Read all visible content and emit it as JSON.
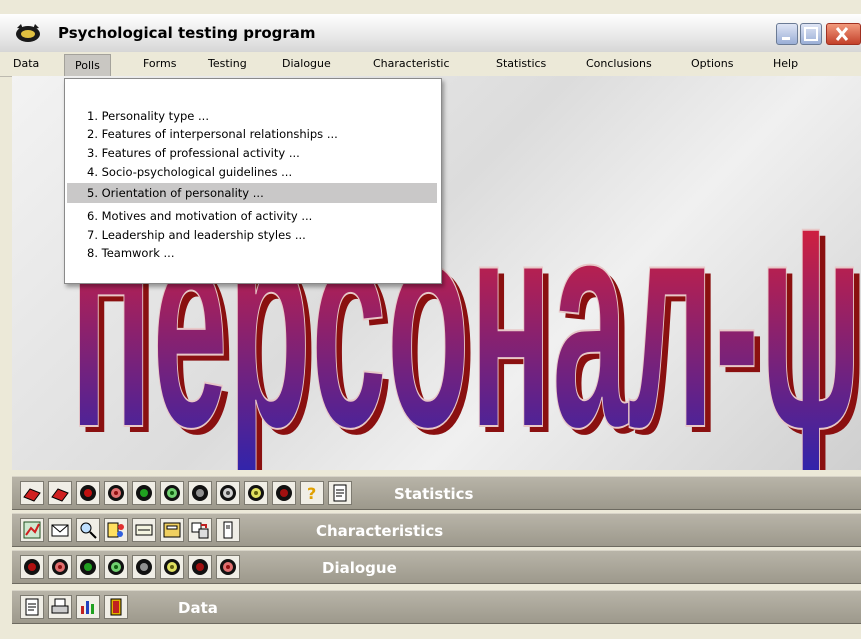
{
  "window": {
    "title": "Psychological testing program"
  },
  "menu": {
    "items": [
      "Data",
      "Polls",
      "Forms",
      "Testing",
      "Dialogue",
      "Characteristic",
      "Statistics",
      "Conclusions",
      "Options",
      "Help"
    ],
    "active": "Polls"
  },
  "dropdown": {
    "items": [
      "1. Personality type ...",
      "2. Features of interpersonal relationships ...",
      "3. Features of professional activity ...",
      "4. Socio-psychological guidelines ...",
      "5. Orientation of personality ...",
      "6. Motives and motivation of activity ...",
      "7. Leadership and leadership styles ...",
      "8. Teamwork ..."
    ],
    "highlighted": "5. Orientation of personality ..."
  },
  "banner": {
    "text": "персонал-ψ",
    "colors": {
      "top": "#ff2020",
      "bottom": "#2a2ab0",
      "shadow": "#8a1010"
    }
  },
  "toolbars": {
    "statistics": {
      "label": "Statistics",
      "icons": [
        "printer-icon",
        "printer-icon",
        "dial-icon",
        "dial-icon",
        "dial-icon",
        "dial-icon",
        "dial-icon",
        "dial-icon",
        "dial-icon",
        "help-icon",
        "document-icon"
      ]
    },
    "characteristics": {
      "label": "Characteristics",
      "icons": [
        "chart-icon",
        "envelope-icon",
        "magnify-icon",
        "paint-icon",
        "card-icon",
        "folder-icon",
        "transfer-icon",
        "device-icon"
      ]
    },
    "dialogue": {
      "label": "Dialogue",
      "icons": [
        "dial-icon",
        "dial-icon",
        "dial-icon",
        "dial-icon",
        "dial-icon",
        "dial-icon",
        "dial-icon",
        "dial-icon"
      ]
    },
    "data": {
      "label": "Data",
      "icons": [
        "document-icon",
        "printer-icon",
        "bar-chart-icon",
        "door-icon"
      ]
    }
  },
  "colors": {
    "toolbar": "#a9a597",
    "menu_bg": "#ece9d8",
    "close_btn": "#d2543a"
  }
}
